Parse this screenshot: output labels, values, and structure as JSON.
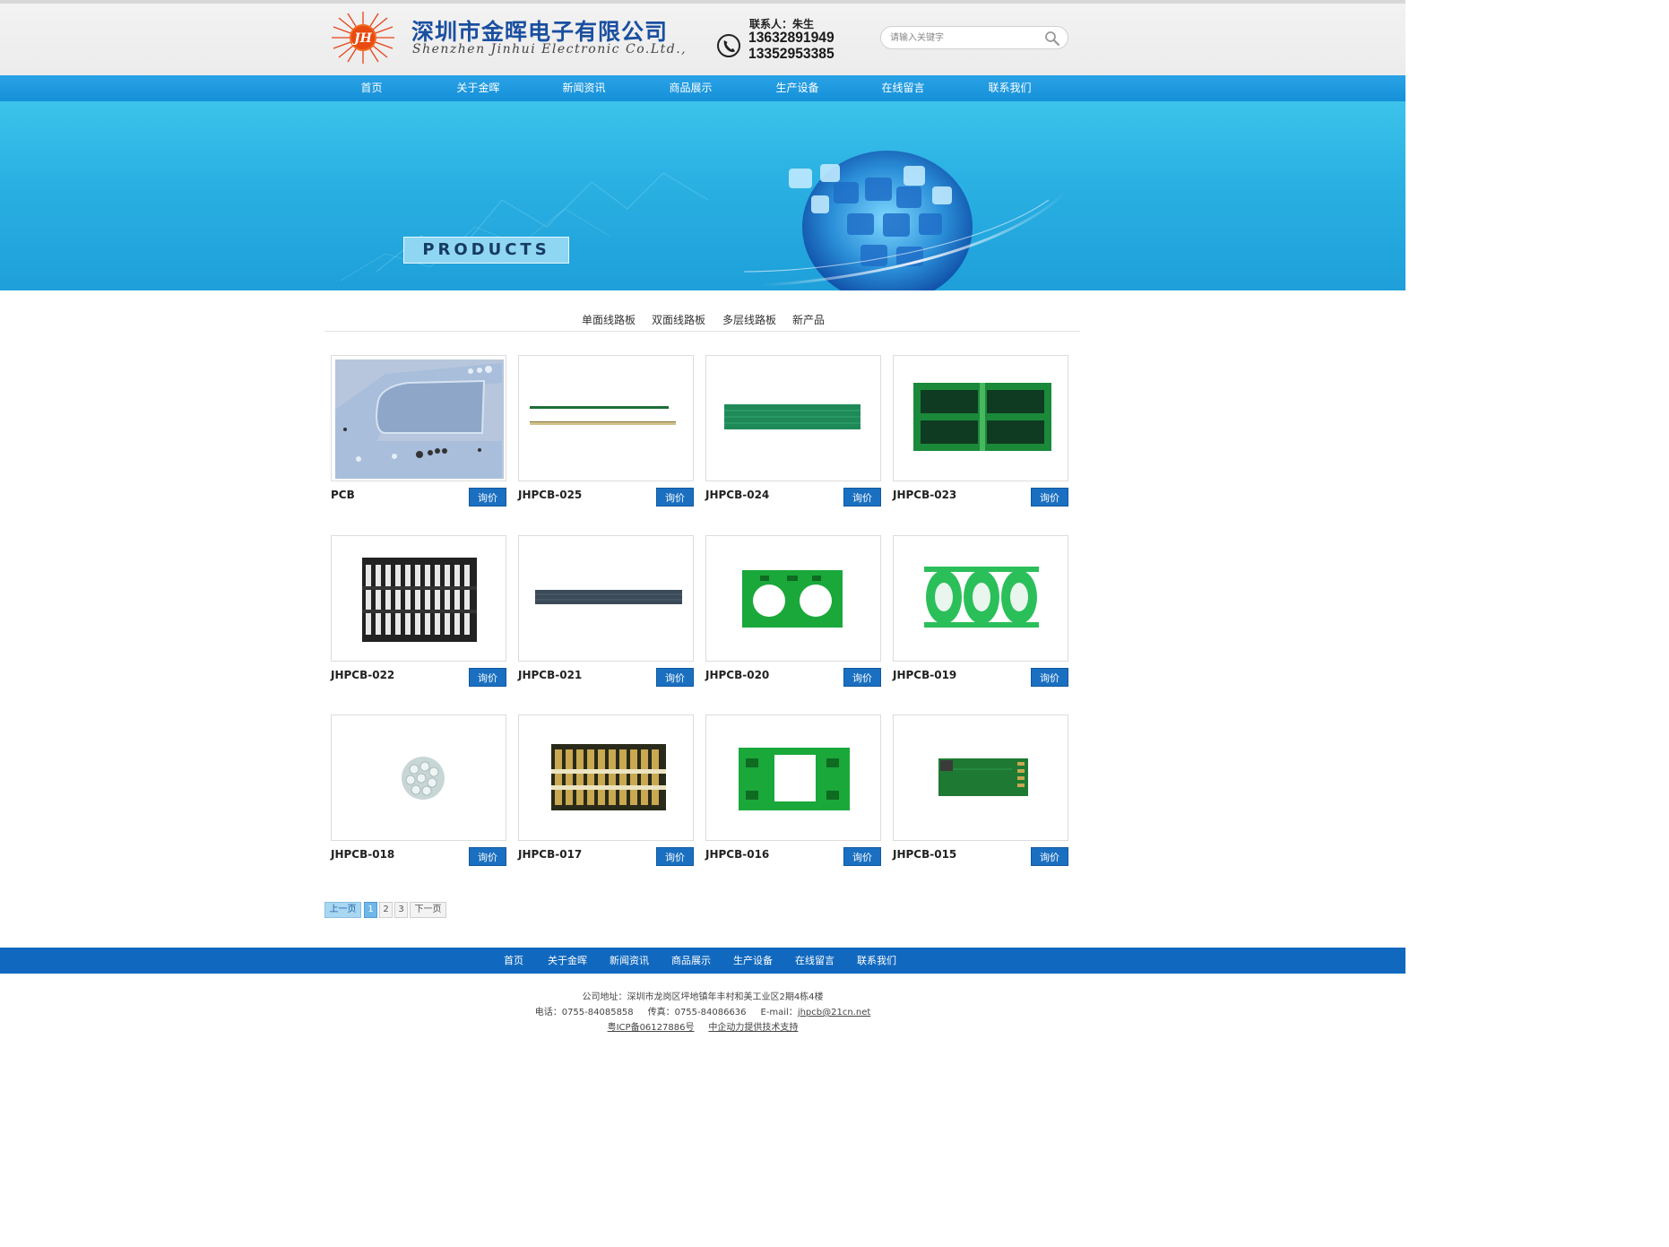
{
  "header": {
    "company_name_cn": "深圳市金晖电子有限公司",
    "company_name_en": "Shenzhen Jinhui Electronic Co.Ltd.,",
    "logo_text": "JH",
    "contact_person": "联系人：朱生",
    "phone_1": "13632891949",
    "phone_2": "13352953385",
    "search_placeholder": "请输入关键字"
  },
  "nav": {
    "items": [
      "首页",
      "关于金晖",
      "新闻资讯",
      "商品展示",
      "生产设备",
      "在线留言",
      "联系我们"
    ]
  },
  "banner": {
    "label": "PRODUCTS"
  },
  "categories": [
    "单面线路板",
    "双面线路板",
    "多层线路板",
    "新产品"
  ],
  "products": [
    {
      "name": "PCB",
      "button": "询价",
      "image": "pcb-aluminum-board"
    },
    {
      "name": "JHPCB-025",
      "button": "询价",
      "image": "pcb-thin-strip"
    },
    {
      "name": "JHPCB-024",
      "button": "询价",
      "image": "pcb-green-panel"
    },
    {
      "name": "JHPCB-023",
      "button": "询价",
      "image": "pcb-quad-green-board"
    },
    {
      "name": "JHPCB-022",
      "button": "询价",
      "image": "pcb-black-white-array"
    },
    {
      "name": "JHPCB-021",
      "button": "询价",
      "image": "pcb-dark-strip"
    },
    {
      "name": "JHPCB-020",
      "button": "询价",
      "image": "pcb-green-circle-holes"
    },
    {
      "name": "JHPCB-019",
      "button": "询价",
      "image": "pcb-green-oval-array"
    },
    {
      "name": "JHPCB-018",
      "button": "询价",
      "image": "pcb-round-led-board"
    },
    {
      "name": "JHPCB-017",
      "button": "询价",
      "image": "pcb-gold-array"
    },
    {
      "name": "JHPCB-016",
      "button": "询价",
      "image": "pcb-green-frame-board"
    },
    {
      "name": "JHPCB-015",
      "button": "询价",
      "image": "pcb-small-green-module"
    }
  ],
  "pagination": {
    "prev": "上一页",
    "pages": [
      "1",
      "2",
      "3"
    ],
    "current": "1",
    "next": "下一页"
  },
  "footer": {
    "nav": [
      "首页",
      "关于金晖",
      "新闻资讯",
      "商品展示",
      "生产设备",
      "在线留言",
      "联系我们"
    ],
    "address": "公司地址：深圳市龙岗区坪地镇年丰村和美工业区2期4栋4楼",
    "phone_label": "电话：",
    "phone": "0755-84085858",
    "fax_label": "传真：",
    "fax": "0755-84086636",
    "email_label": "E-mail：",
    "email": "jhpcb@21cn.net",
    "icp": "粤ICP备06127886号",
    "support": "中企动力提供技术支持"
  },
  "colors": {
    "nav_blue": "#1a95dc",
    "footer_blue": "#1169bf",
    "button_blue": "#1a6fc0",
    "title_blue": "#1a4fa0"
  }
}
